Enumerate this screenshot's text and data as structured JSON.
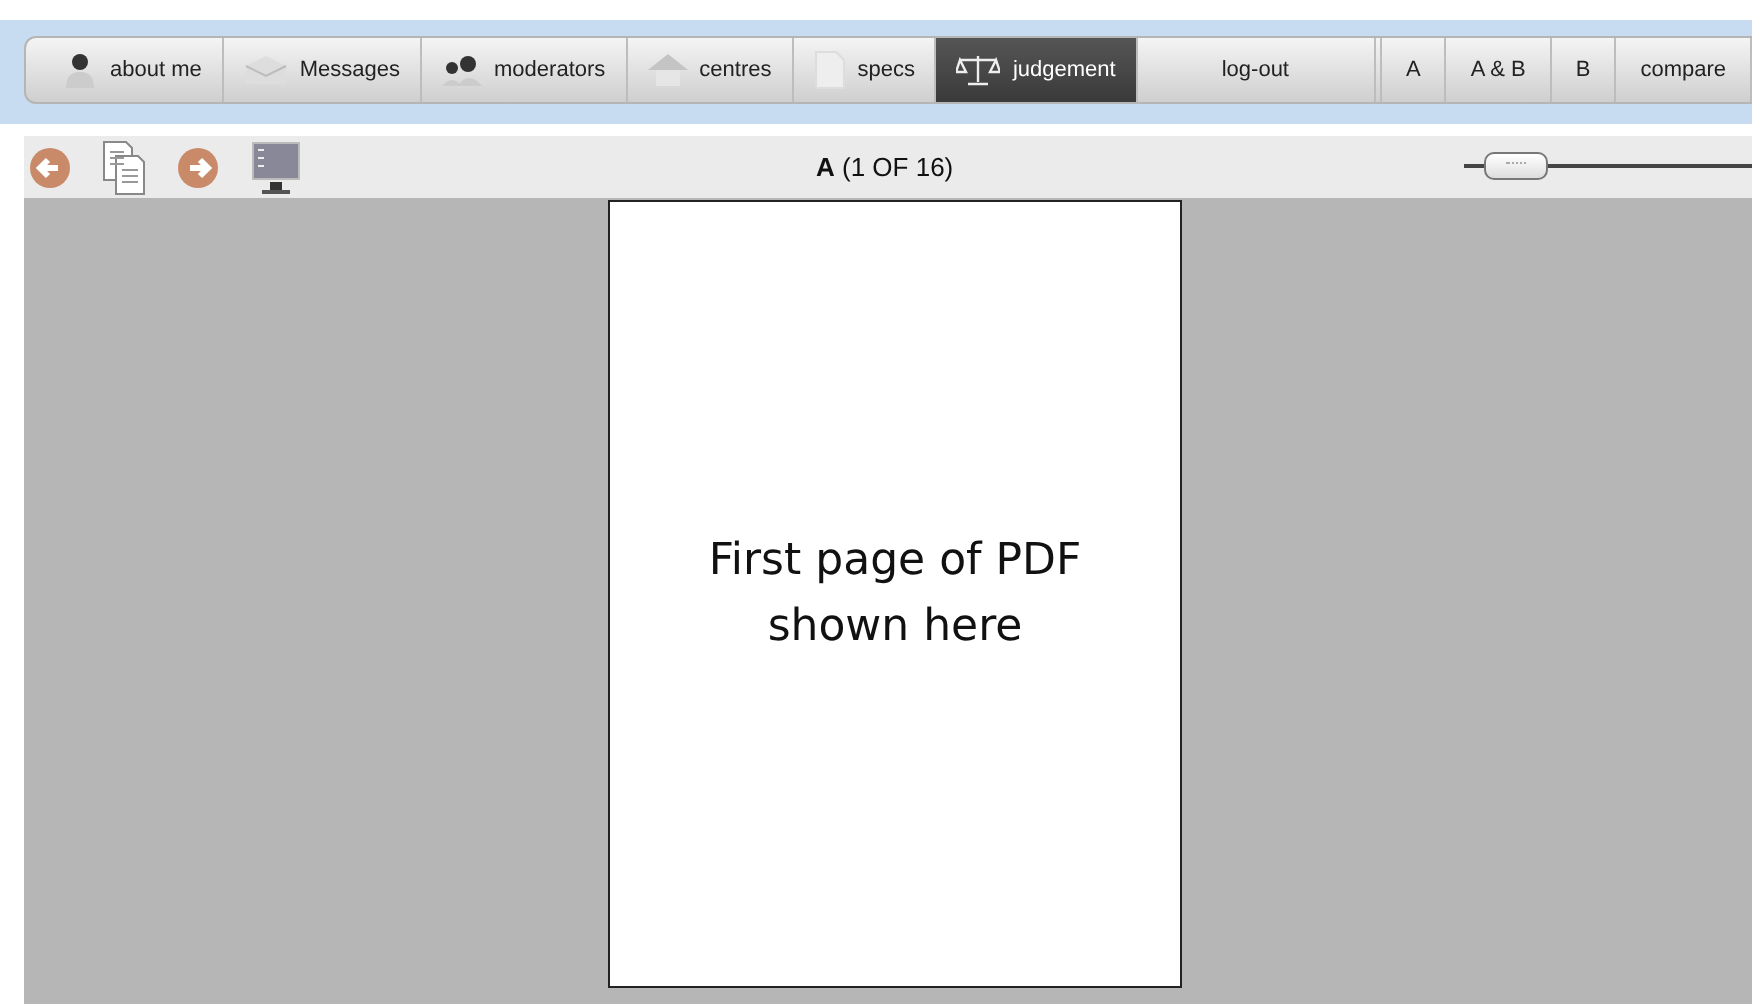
{
  "nav": {
    "items": [
      {
        "label": "about me",
        "kind": "person",
        "selected": false
      },
      {
        "label": "Messages",
        "kind": "envelope",
        "selected": false
      },
      {
        "label": "moderators",
        "kind": "people",
        "selected": false
      },
      {
        "label": "centres",
        "kind": "house",
        "selected": false
      },
      {
        "label": "specs",
        "kind": "document",
        "selected": false
      },
      {
        "label": "judgement",
        "kind": "scales",
        "selected": true
      },
      {
        "label": "log-out",
        "kind": "plain",
        "selected": false
      }
    ],
    "views": [
      {
        "label": "A",
        "selected": false
      },
      {
        "label": "A & B",
        "selected": false
      },
      {
        "label": "B",
        "selected": false
      },
      {
        "label": "compare",
        "selected": false
      }
    ]
  },
  "viewer": {
    "title": "**A** (1 OF 16)",
    "page_text": [
      "First page of PDF",
      "shown here"
    ]
  }
}
